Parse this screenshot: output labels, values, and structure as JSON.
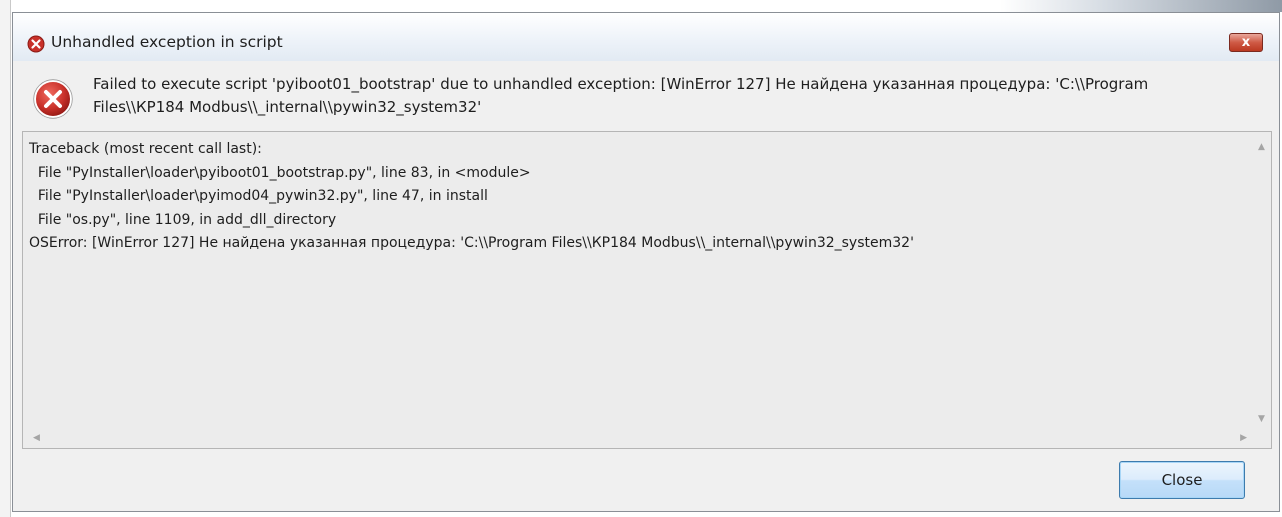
{
  "window": {
    "title": "Unhandled exception in script",
    "close_glyph": "x"
  },
  "message": {
    "text": "Failed to execute script 'pyiboot01_bootstrap' due to unhandled exception: [WinError 127] Не найдена указанная процедура: 'C:\\\\Program Files\\\\КР184 Modbus\\\\_internal\\\\pywin32_system32'"
  },
  "traceback": {
    "lines": [
      "Traceback (most recent call last):",
      "  File \"PyInstaller\\loader\\pyiboot01_bootstrap.py\", line 83, in <module>",
      "  File \"PyInstaller\\loader\\pyimod04_pywin32.py\", line 47, in install",
      "  File \"os.py\", line 1109, in add_dll_directory",
      "OSError: [WinError 127] Не найдена указанная процедура: 'C:\\\\Program Files\\\\КР184 Modbus\\\\_internal\\\\pywin32_system32'"
    ]
  },
  "buttons": {
    "close_label": "Close"
  },
  "icons": {
    "error": "error-icon",
    "scroll_up": "scroll-up-arrow-icon",
    "scroll_down": "scroll-down-arrow-icon",
    "scroll_left": "scroll-left-arrow-icon",
    "scroll_right": "scroll-right-arrow-icon"
  },
  "colors": {
    "error_red": "#c8312a",
    "dialog_bg": "#f0f0f0",
    "close_x_red": "#c9452f",
    "button_border": "#3d7bad"
  }
}
